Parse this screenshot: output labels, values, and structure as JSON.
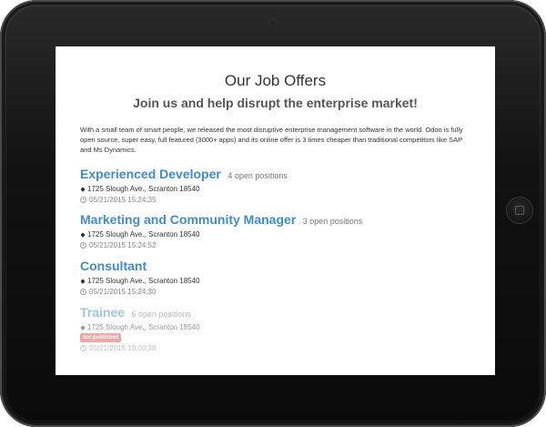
{
  "page": {
    "title": "Our Job Offers",
    "subtitle": "Join us and help disrupt the enterprise market!",
    "intro": "With a small team of smart people, we released the most disruptive enterprise management software in the world. Odoo is fully open source, super easy, full featured (3000+ apps) and its online offer is 3 times cheaper than traditional competitors like SAP and Ms Dynamics."
  },
  "jobs": [
    {
      "title": "Experienced Developer",
      "positions": "4 open positions",
      "address": "1725 Slough Ave., Scranton 18540",
      "date": "05/21/2015 15:24:35"
    },
    {
      "title": "Marketing and Community Manager",
      "positions": "3 open positions",
      "address": "1725 Slough Ave., Scranton 18540",
      "date": "05/21/2015 15:24:52"
    },
    {
      "title": "Consultant",
      "positions": "",
      "address": "1725 Slough Ave., Scranton 18540",
      "date": "05/21/2015 15:24:30"
    },
    {
      "title": "Trainee",
      "positions": "6 open positions",
      "address": "1725 Slough Ave., Scranton 18540",
      "badge": "not published",
      "date": "05/21/2015 10:00:38"
    }
  ],
  "colors": {
    "link": "#428bca",
    "badge": "#d9534f"
  }
}
